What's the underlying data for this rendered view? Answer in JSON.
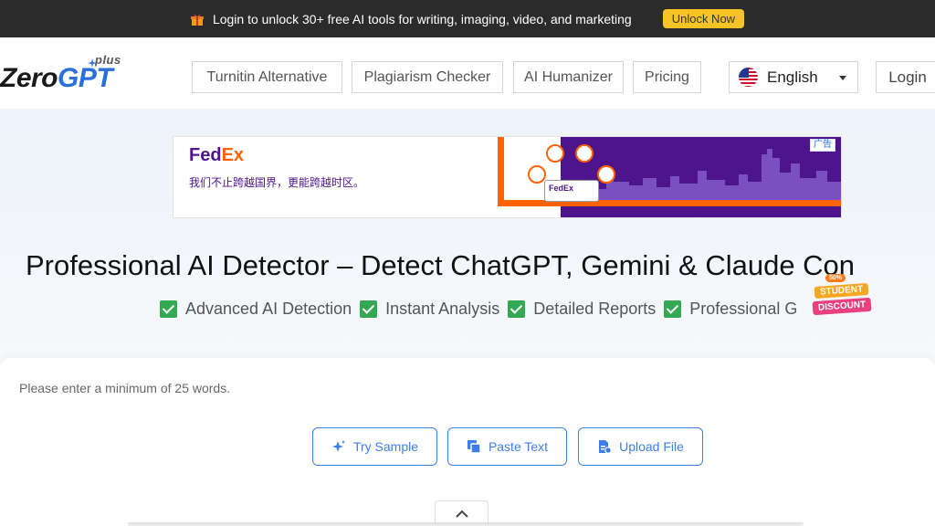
{
  "promo": {
    "text": "Login to unlock 30+ free AI tools for writing, imaging, video, and marketing",
    "button": "Unlock Now"
  },
  "header": {
    "logo_zero": "Zero",
    "logo_gpt": "GPT",
    "logo_plus": "plus",
    "nav": [
      "Turnitin Alternative",
      "Plagiarism Checker",
      "AI Humanizer",
      "Pricing"
    ],
    "language": "English",
    "login": "Login"
  },
  "ad": {
    "brand_fed": "Fed",
    "brand_ex": "Ex",
    "tagline": "我们不止跨越国界，更能跨越时区。",
    "badge": "广告",
    "truck_label": "FedEx"
  },
  "hero": {
    "title": "Professional AI Detector – Detect ChatGPT, Gemini & Claude Con",
    "features": [
      "Advanced AI Detection",
      "Instant Analysis",
      "Detailed Reports",
      "Professional G"
    ]
  },
  "sticker": {
    "top": "50%",
    "mid": "STUDENT",
    "bot": "DISCOUNT"
  },
  "card": {
    "hint": "Please enter a minimum of 25 words.",
    "try_sample": "Try Sample",
    "paste_text": "Paste Text",
    "upload_file": "Upload File"
  },
  "colors": {
    "accent": "#3d7ee8",
    "promo_bg": "#2b2b2b",
    "promo_button": "#f7c325",
    "check": "#34a853",
    "fedex_purple": "#4d148c",
    "fedex_orange": "#ff6200"
  }
}
